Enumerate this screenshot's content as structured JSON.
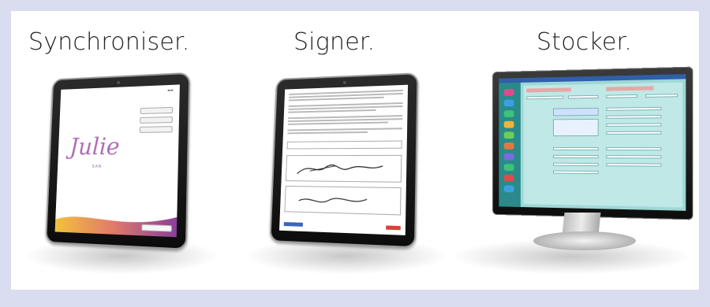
{
  "headings": [
    "Synchroniser.",
    "Signer.",
    "Stocker."
  ],
  "logo": {
    "script": "Julie",
    "sub": "SAN"
  },
  "colors": {
    "background": "#dadcef",
    "panel": "#ffffff",
    "julie_purple": "#b06bb5",
    "software_teal": "#9fd7d6",
    "software_title": "#2f5fa8"
  },
  "devices": [
    "tablet-synchronise",
    "tablet-signature",
    "desktop-monitor"
  ]
}
